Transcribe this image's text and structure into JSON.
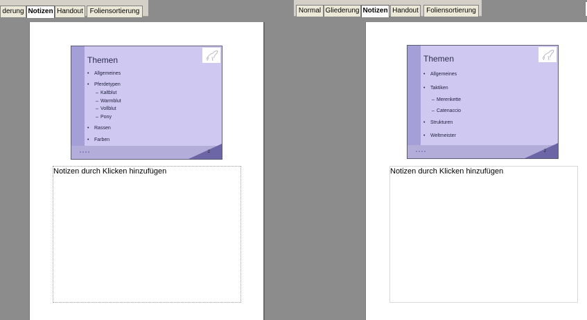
{
  "left": {
    "tabs": [
      {
        "label": "derung",
        "active": false
      },
      {
        "label": "Notizen",
        "active": true
      },
      {
        "label": "Handout",
        "active": false
      },
      {
        "label": "Foliensortierung",
        "active": false
      }
    ],
    "slide": {
      "title": "Themen",
      "bullets": [
        {
          "text": "Allgemeines",
          "level": 1
        },
        {
          "text": "Pferdetypen",
          "level": 1
        },
        {
          "text": "Kaltblut",
          "level": 2
        },
        {
          "text": "Warmblut",
          "level": 2
        },
        {
          "text": "Vollblut",
          "level": 2
        },
        {
          "text": "Pony",
          "level": 2
        },
        {
          "text": "Rassen",
          "level": 1
        },
        {
          "text": "Farben",
          "level": 1
        }
      ],
      "page_number": "2"
    },
    "notes_placeholder": "Notizen durch Klicken hinzufügen"
  },
  "right": {
    "tabs": [
      {
        "label": "Normal",
        "active": false
      },
      {
        "label": "Gliederung",
        "active": false
      },
      {
        "label": "Notizen",
        "active": true
      },
      {
        "label": "Handout",
        "active": false
      },
      {
        "label": "Foliensortierung",
        "active": false
      }
    ],
    "slide": {
      "title": "Themen",
      "bullets": [
        {
          "text": "Allgemeines",
          "level": 1
        },
        {
          "text": "Taktiken",
          "level": 1
        },
        {
          "text": "Merenkette",
          "level": 2
        },
        {
          "text": "Catenaccio",
          "level": 2
        },
        {
          "text": "Strukturen",
          "level": 1
        },
        {
          "text": "Weltmeister",
          "level": 1
        }
      ],
      "page_number": "2"
    },
    "notes_placeholder": "Notizen durch Klicken hinzufügen"
  },
  "colors": {
    "slide_background": "#cfc9f2",
    "slide_band": "#a49fd6",
    "slide_accent": "#6d66a6",
    "canvas": "#8c8c8c"
  }
}
